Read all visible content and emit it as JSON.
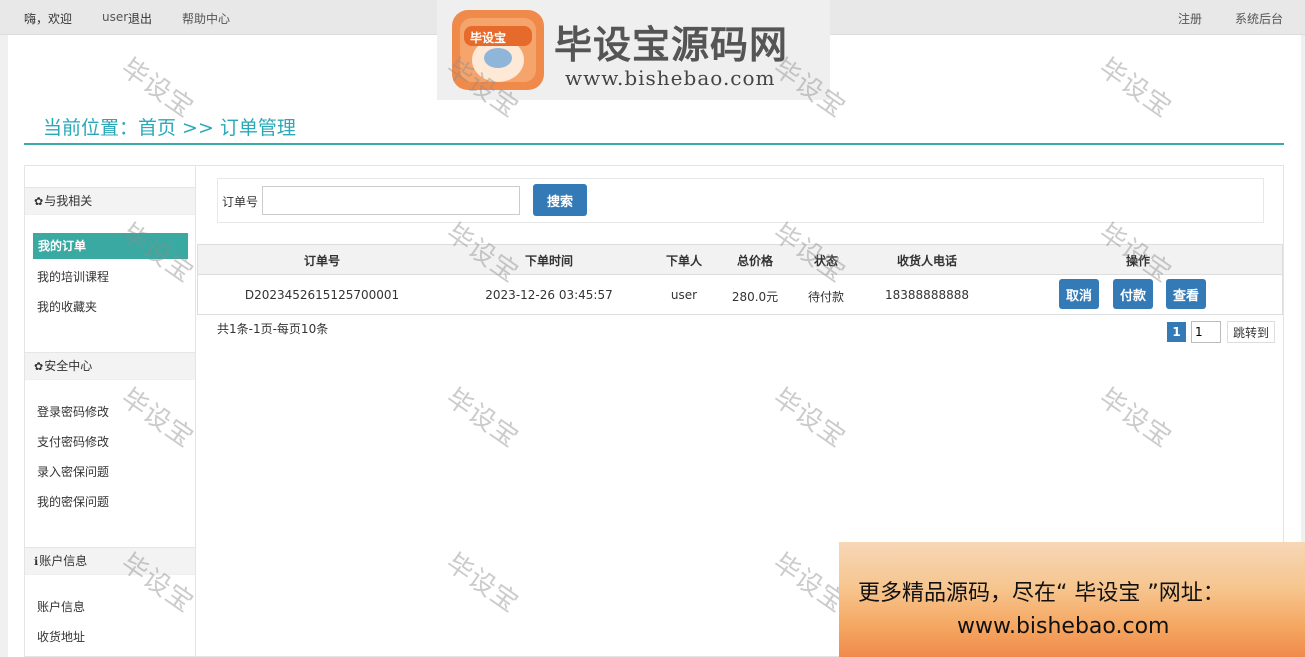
{
  "topbar": {
    "greeting": "嗨，欢迎",
    "user": "user",
    "logout": "退出",
    "help": "帮助中心",
    "register": "注册",
    "admin": "系统后台"
  },
  "logo": {
    "badge_text": "毕设宝",
    "title": "毕设宝源码网",
    "url": "www.bishebao.com"
  },
  "breadcrumb": "当前位置：首页 >> 订单管理",
  "sidebar": {
    "sections": [
      {
        "icon": "gear-icon",
        "title": "与我相关",
        "items": [
          "我的订单",
          "我的培训课程",
          "我的收藏夹"
        ]
      },
      {
        "icon": "gear-icon",
        "title": "安全中心",
        "items": [
          "登录密码修改",
          "支付密码修改",
          "录入密保问题",
          "我的密保问题"
        ]
      },
      {
        "icon": "info-icon",
        "title": "账户信息",
        "items": [
          "账户信息",
          "收货地址"
        ]
      }
    ],
    "active": "我的订单"
  },
  "search": {
    "label": "订单号",
    "value": "",
    "button": "搜索"
  },
  "table": {
    "headers": [
      "订单号",
      "下单时间",
      "下单人",
      "总价格",
      "状态",
      "收货人电话",
      "操作"
    ],
    "rows": [
      {
        "order_no": "D2023452615125700001",
        "time": "2023-12-26 03:45:57",
        "user": "user",
        "price": "280.0元",
        "status": "待付款",
        "phone": "18388888888",
        "actions": [
          "取消",
          "付款",
          "查看"
        ]
      }
    ]
  },
  "pagination": {
    "summary": "共1条-1页-每页10条",
    "current": "1",
    "input_value": "1",
    "jump": "跳转到"
  },
  "watermark": "毕设宝",
  "promo": {
    "line1": "更多精品源码，尽在“ 毕设宝 ”网址：",
    "line2": "www.bishebao.com"
  },
  "colors": {
    "accent": "#3aa9a2",
    "button": "#337ab7",
    "breadcrumb": "#2aa8b8"
  }
}
